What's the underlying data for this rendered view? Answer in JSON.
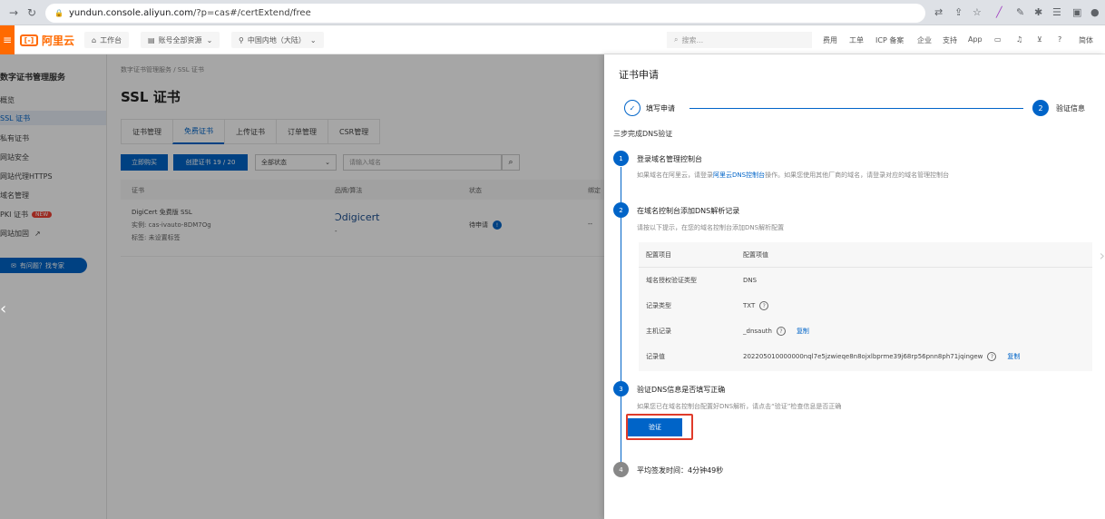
{
  "browser": {
    "url_domain": "yundun.console.aliyun.com",
    "url_path": "/?p=cas#/certExtend/free"
  },
  "header": {
    "logo_text": "阿里云",
    "workbench": "工作台",
    "account": "账号全部资源",
    "region": "中国内地（大陆）",
    "search_placeholder": "搜索...",
    "links": [
      "费用",
      "工单",
      "ICP 备案",
      "企业",
      "支持",
      "App"
    ],
    "lang": "简体"
  },
  "sidebar": {
    "title": "数字证书管理服务",
    "items": [
      "概览",
      "SSL 证书",
      "私有证书",
      "网站安全",
      "网站代理HTTPS",
      "域名管理",
      "PKI 证书",
      "网站加固"
    ],
    "new_badge": "NEW",
    "help": "有问题？找专家"
  },
  "main": {
    "breadcrumb": "数字证书管理服务  /  SSL 证书",
    "title": "SSL 证书",
    "tabs": [
      "证书管理",
      "免费证书",
      "上传证书",
      "订单管理",
      "CSR管理"
    ],
    "buy_btn": "立即购买",
    "create_btn": "创建证书 19 / 20",
    "status_select": "全部状态",
    "domain_placeholder": "请输入域名",
    "columns": [
      "证书",
      "品牌/算法",
      "状态",
      "绑定"
    ],
    "row": {
      "name": "DigiCert 免费版 SSL",
      "instance": "实例: cas-ivauto-8DM7Og",
      "tag": "标签: 未设置标签",
      "brand": "digicert",
      "brand_sub": "-",
      "status": "待申请",
      "bind": "--"
    }
  },
  "drawer": {
    "title": "证书申请",
    "step1": "填写申请",
    "step2_num": "2",
    "step2": "验证信息",
    "section_title": "三步完成DNS验证",
    "steps": [
      {
        "num": "1",
        "title": "登录域名管理控制台",
        "desc_pre": "如果域名在阿里云，请登录",
        "desc_link": "阿里云DNS控制台",
        "desc_post": "操作。如果您使用其他厂商的域名，请登录对应的域名管理控制台"
      },
      {
        "num": "2",
        "title": "在域名控制台添加DNS解析记录",
        "desc": "请按以下提示，在您的域名控制台添加DNS解析配置"
      },
      {
        "num": "3",
        "title": "验证DNS信息是否填写正确",
        "desc": "如果您已在域名控制台配置好DNS解析，请点击“验证”检查信息是否正确"
      },
      {
        "num": "4",
        "title": "平均签发时间：4分钟49秒"
      }
    ],
    "table": {
      "header_key": "配置项目",
      "header_val": "配置项值",
      "rows": [
        {
          "key": "域名授权验证类型",
          "val": "DNS"
        },
        {
          "key": "记录类型",
          "val": "TXT"
        },
        {
          "key": "主机记录",
          "val": "_dnsauth"
        },
        {
          "key": "记录值",
          "val": "202205010000000nql7e5jzwieqe8n8ojxlbprme39j68rp56pnn8ph71jqingew"
        }
      ],
      "copy": "复制"
    },
    "verify_btn": "验证"
  }
}
